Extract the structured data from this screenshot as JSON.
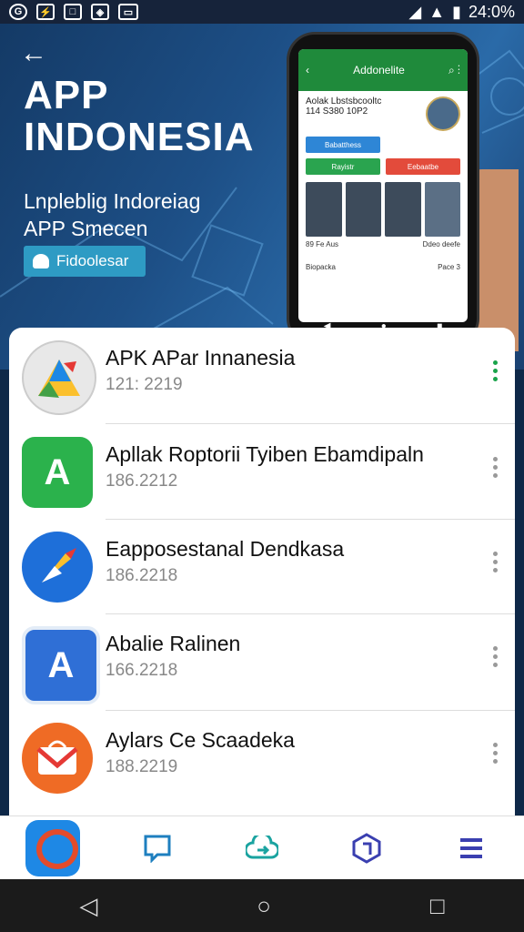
{
  "status_bar": {
    "time": "24:0%",
    "left_icons": [
      "g-circle-icon",
      "flash-icon",
      "box-icon",
      "shield-icon",
      "car-icon"
    ],
    "right_icons": [
      "wifi-icon",
      "signal-icon",
      "battery-icon"
    ]
  },
  "hero": {
    "title_line1": "APP",
    "title_line2": "INDONESIA",
    "subtitle_line1": "Lnpleblig Indoreiag",
    "subtitle_line2": "APP Smecen",
    "button_label": "Fidoolesar"
  },
  "phone_preview": {
    "app_title": "Addonelite",
    "line1": "Aolak Lbstsbcooltc",
    "line2": "114 S380 10P2",
    "btn1": "Babatthess",
    "btn2": "Eebaatbe",
    "btn3": "Rayistr",
    "btn4": "Eebaattbe",
    "cap1": "89 Fe Aus",
    "cap2": "Ddeo deefe",
    "cap3": "Biopacka",
    "cap4": "Pace 3"
  },
  "apps": [
    {
      "name": "APK APar Innanesia",
      "version": "121: 2219",
      "icon": "drive-triangle-icon"
    },
    {
      "name": "Apllak Roptorii Tyiben Ebamdipaln",
      "version": "186.2212",
      "icon": "app-store-a-icon"
    },
    {
      "name": "Eapposestanal Dendkasa",
      "version": "186.2218",
      "icon": "compass-pen-icon"
    },
    {
      "name": "Abalie Ralinen",
      "version": "166.2218",
      "icon": "a-arrow-icon"
    },
    {
      "name": "Aylars Ce Scaadeka",
      "version": "188.2219",
      "icon": "shopping-bag-mail-icon"
    }
  ],
  "bottom_nav": [
    "home-app-icon",
    "chat-icon",
    "cloud-share-icon",
    "hex-badge-icon",
    "menu-icon"
  ],
  "system_nav": [
    "back-icon",
    "home-icon",
    "recents-icon"
  ],
  "colors": {
    "accent_green": "#19a34a",
    "hero_button": "#2e9bc4",
    "phone_bar": "#1f8a3b"
  }
}
